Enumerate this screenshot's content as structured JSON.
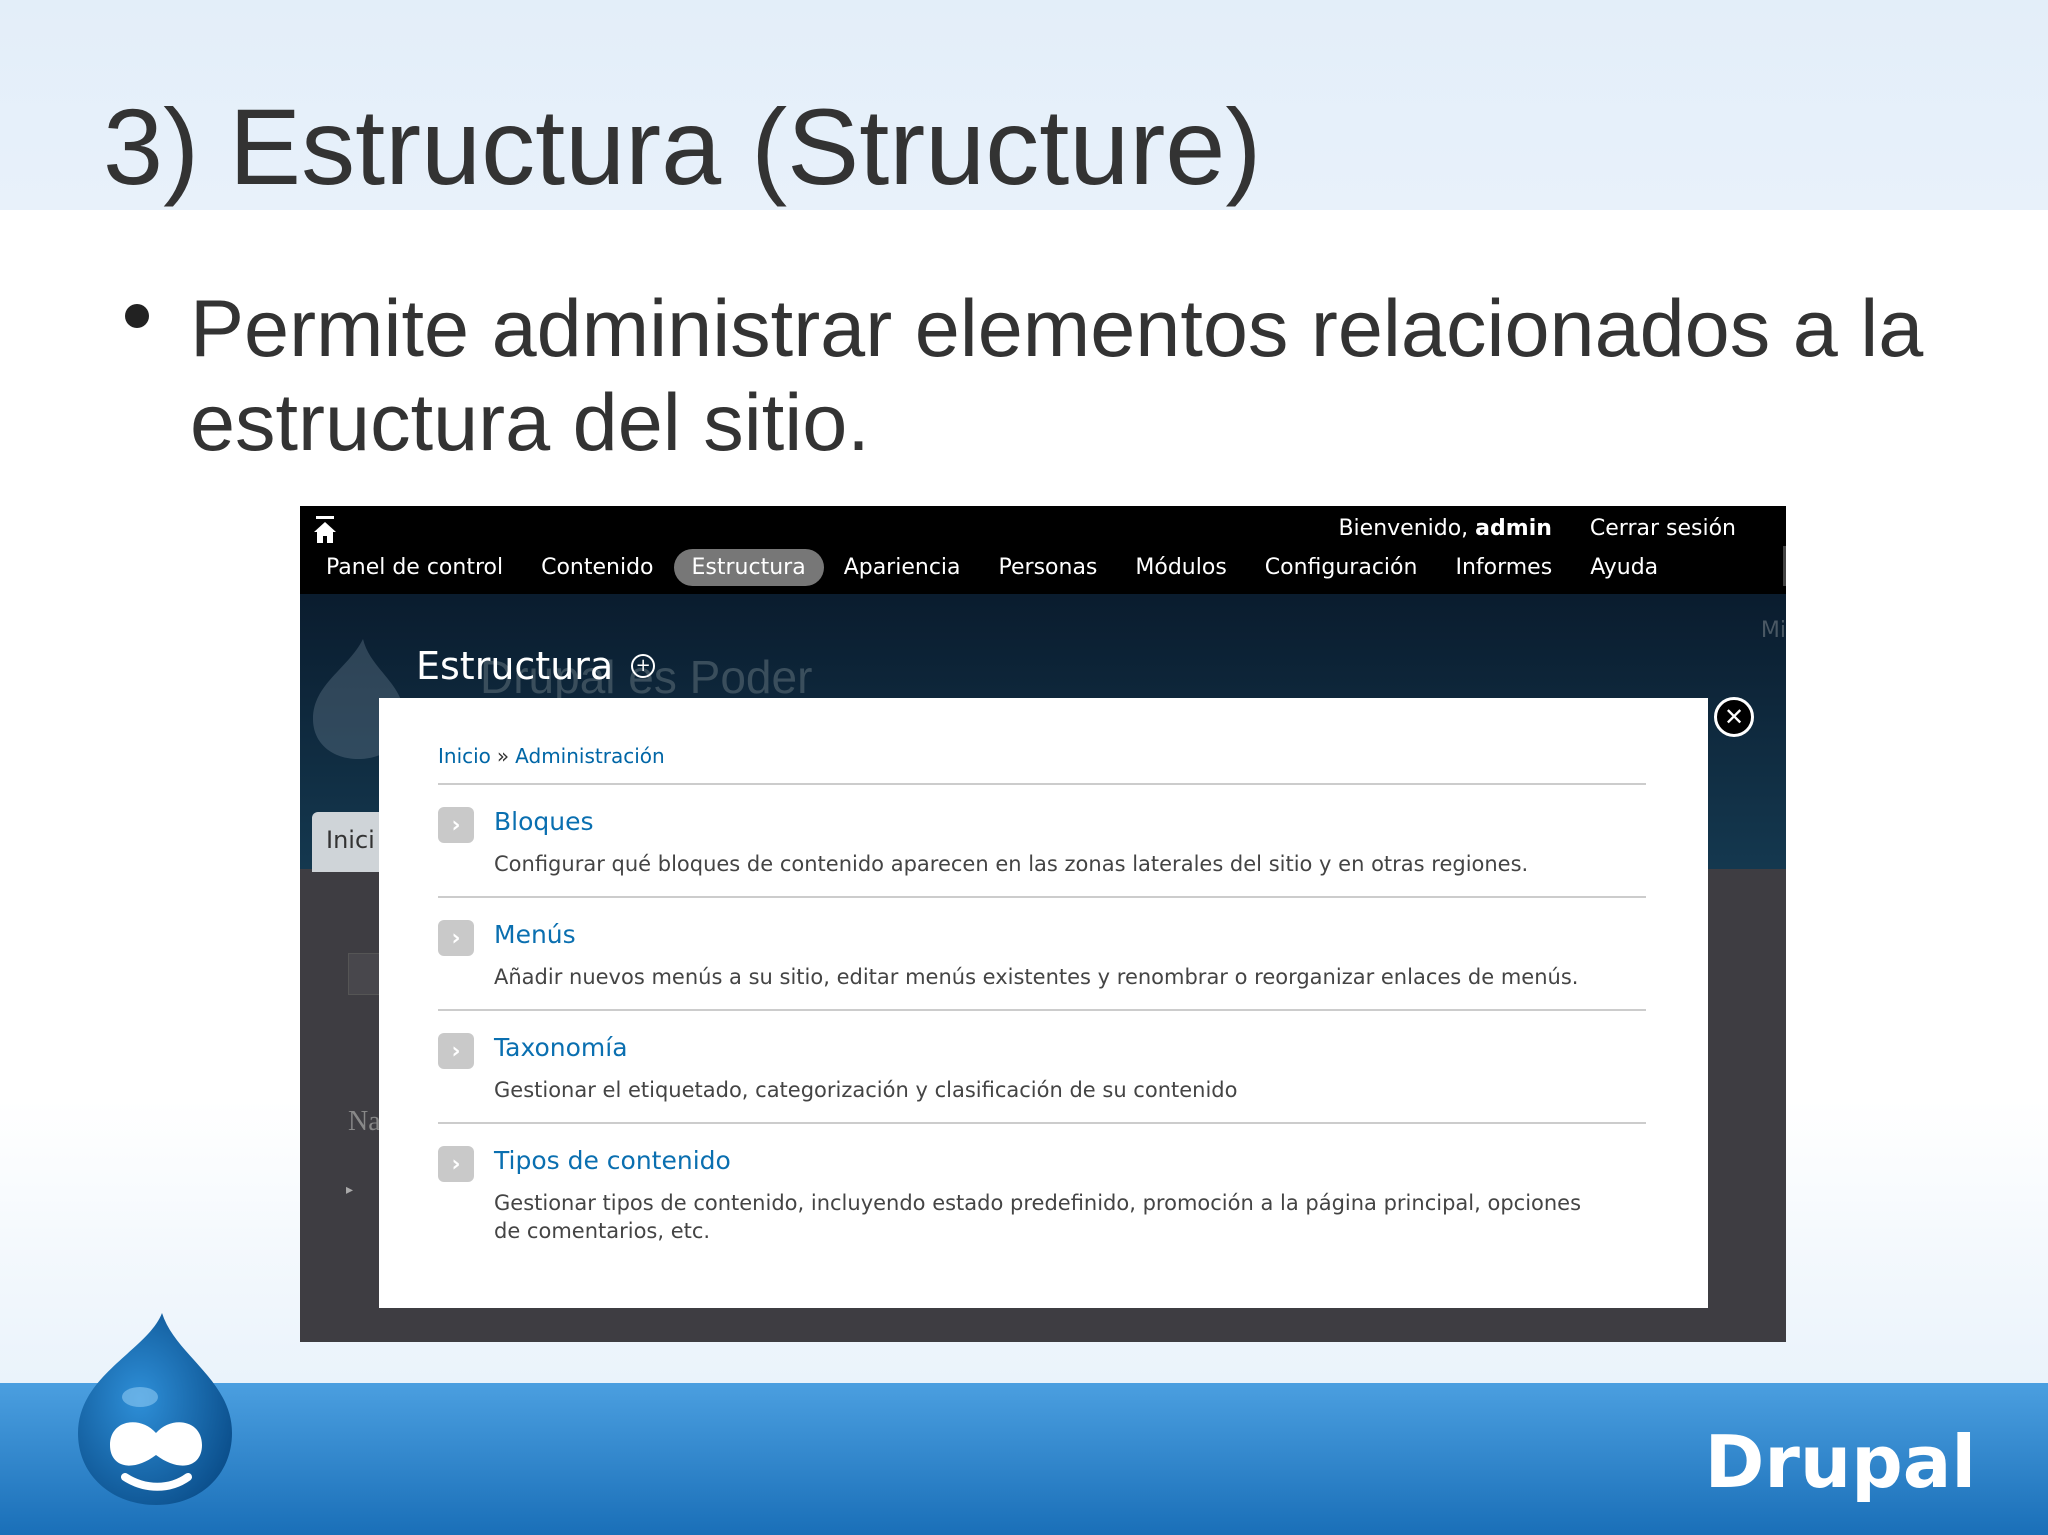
{
  "slide": {
    "title": "3) Estructura (Structure)",
    "bullet": "Permite administrar elementos relacionados a la estructura del sitio."
  },
  "toolbar": {
    "welcome_prefix": "Bienvenido, ",
    "username": "admin",
    "logout": "Cerrar sesión",
    "menu": [
      "Panel de control",
      "Contenido",
      "Estructura",
      "Apariencia",
      "Personas",
      "Módulos",
      "Configuración",
      "Informes",
      "Ayuda"
    ],
    "active": "Estructura"
  },
  "background": {
    "site_name": "Drupal es Poder",
    "top_right": "Mi",
    "tab": "Inici",
    "na": "Na"
  },
  "page": {
    "heading": "Estructura"
  },
  "overlay": {
    "breadcrumb": [
      "Inicio",
      "Administración"
    ],
    "separator": "»",
    "items": [
      {
        "title": "Bloques",
        "description": "Configurar qué bloques de contenido aparecen en las zonas laterales del sitio y en otras regiones."
      },
      {
        "title": "Menús",
        "description": "Añadir nuevos menús a su sitio, editar menús existentes y renombrar o reorganizar enlaces de menús."
      },
      {
        "title": "Taxonomía",
        "description": "Gestionar el etiquetado, categorización y clasificación de su contenido"
      },
      {
        "title": "Tipos de contenido",
        "description": "Gestionar tipos de contenido, incluyendo estado predefinido, promoción a la página principal, opciones de comentarios, etc."
      }
    ]
  },
  "footer": {
    "brand": "Drupal"
  },
  "colors": {
    "link": "#0a6fb0",
    "toolbar_bg": "#000000",
    "active_tab": "#777777",
    "footer_band": "#1a6fb8"
  }
}
